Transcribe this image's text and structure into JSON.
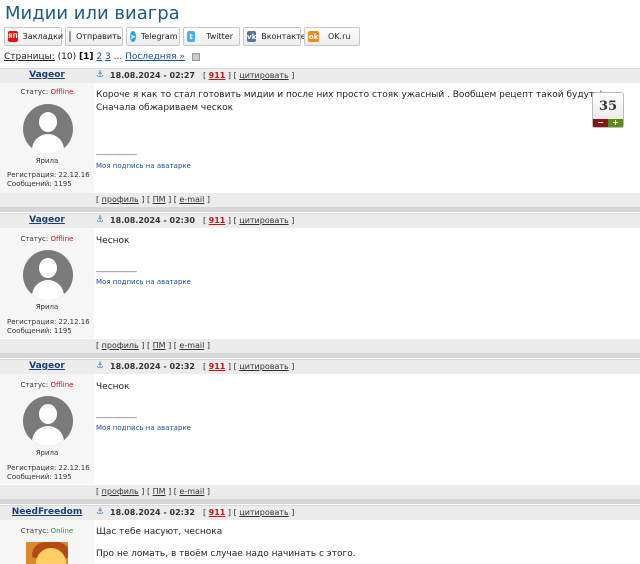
{
  "page_title": "Мидии или виагра",
  "share": [
    {
      "label": "Закладки",
      "icon": "yandex-bookmark-icon"
    },
    {
      "label": "Отправить",
      "icon": "mail-icon"
    },
    {
      "label": "Telegram",
      "icon": "telegram-icon"
    },
    {
      "label": "Twitter",
      "icon": "twitter-icon"
    },
    {
      "label": "Вконтакте",
      "icon": "vk-icon"
    },
    {
      "label": "OK.ru",
      "icon": "ok-icon"
    }
  ],
  "pagination": {
    "prefix": "Страницы:",
    "count": "(10)",
    "current": "[1]",
    "page2": "2",
    "page3": "3",
    "ellipsis": "...",
    "last": "Последняя »"
  },
  "posts": [
    {
      "author": "Vageor",
      "date": "18.08.2024 - 02:27",
      "number": "911",
      "quote": "цитировать",
      "status_label": "Статус:",
      "status": "Offline",
      "rank": "Ярила",
      "reg": "Регистрация: 22.12.16",
      "msgs": "Сообщений: 1195",
      "text1": "Короче я как то стал готовить мидии и после них просто стояк ужасный . Вообщем рецепт такой будут фото",
      "text2": "Сначала обжариваем ческок",
      "sig_line": "--------------------",
      "signature": "Моя подпись на аватарке",
      "foot_profile": "профиль",
      "foot_pm": "ПМ",
      "foot_email": "e-mail"
    },
    {
      "author": "Vageor",
      "date": "18.08.2024 - 02:30",
      "number": "911",
      "quote": "цитировать",
      "status_label": "Статус:",
      "status": "Offline",
      "rank": "Ярила",
      "reg": "Регистрация: 22.12.16",
      "msgs": "Сообщений: 1195",
      "text1": "Чеснок",
      "sig_line": "--------------------",
      "signature": "Моя подпись на аватарке",
      "foot_profile": "профиль",
      "foot_pm": "ПМ",
      "foot_email": "e-mail"
    },
    {
      "author": "Vageor",
      "date": "18.08.2024 - 02:32",
      "number": "911",
      "quote": "цитировать",
      "status_label": "Статус:",
      "status": "Offline",
      "rank": "Ярила",
      "reg": "Регистрация: 22.12.16",
      "msgs": "Сообщений: 1195",
      "text1": "Чеснок",
      "sig_line": "--------------------",
      "signature": "Моя подпись на аватарке",
      "foot_profile": "профиль",
      "foot_pm": "ПМ",
      "foot_email": "e-mail"
    },
    {
      "author": "NeedFreedom",
      "date": "18.08.2024 - 02:32",
      "number": "911",
      "quote": "цитировать",
      "status_label": "Статус:",
      "status": "Online",
      "text1": "Щас тебе насуют, чеснока",
      "text2": "Про не ломать, в твоём случае надо начинать с этого."
    }
  ],
  "rating": {
    "value": "35",
    "minus": "−",
    "plus": "+"
  },
  "colors": {
    "title": "#1d5c8a",
    "offline": "#c0161a",
    "online": "#2a9a2a",
    "post_number": "#c0161a"
  }
}
